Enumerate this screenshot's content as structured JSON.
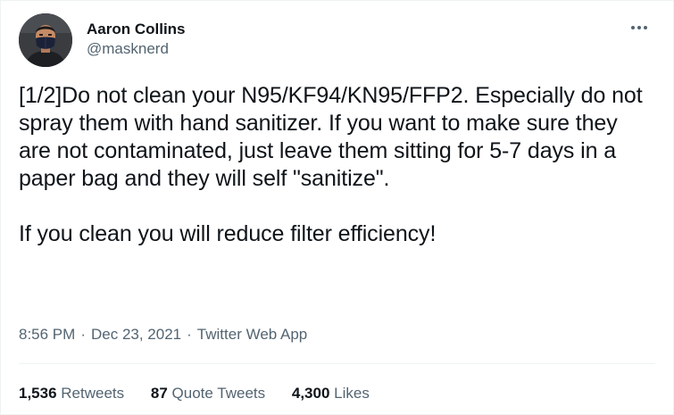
{
  "author": {
    "display_name": "Aaron Collins",
    "handle": "@masknerd",
    "avatar": "profile photo of a man wearing a dark face mask"
  },
  "more_icon": "more-horizontal-icon",
  "tweet": {
    "text": "[1/2]Do not clean your N95/KF94/KN95/FFP2. Especially do not spray them with hand sanitizer. If you want to make sure they are not contaminated, just leave them sitting for 5-7 days in a paper bag and they will self \"sanitize\".\n\nIf you clean you will reduce filter efficiency!"
  },
  "meta": {
    "time": "8:56 PM",
    "separator": "·",
    "date": "Dec 23, 2021",
    "source": "Twitter Web App"
  },
  "stats": {
    "retweets_count": "1,536",
    "retweets_label": "Retweets",
    "quotes_count": "87",
    "quotes_label": "Quote Tweets",
    "likes_count": "4,300",
    "likes_label": "Likes"
  },
  "colors": {
    "text_primary": "#0f1419",
    "text_secondary": "#536471",
    "divider": "#eff3f4"
  }
}
